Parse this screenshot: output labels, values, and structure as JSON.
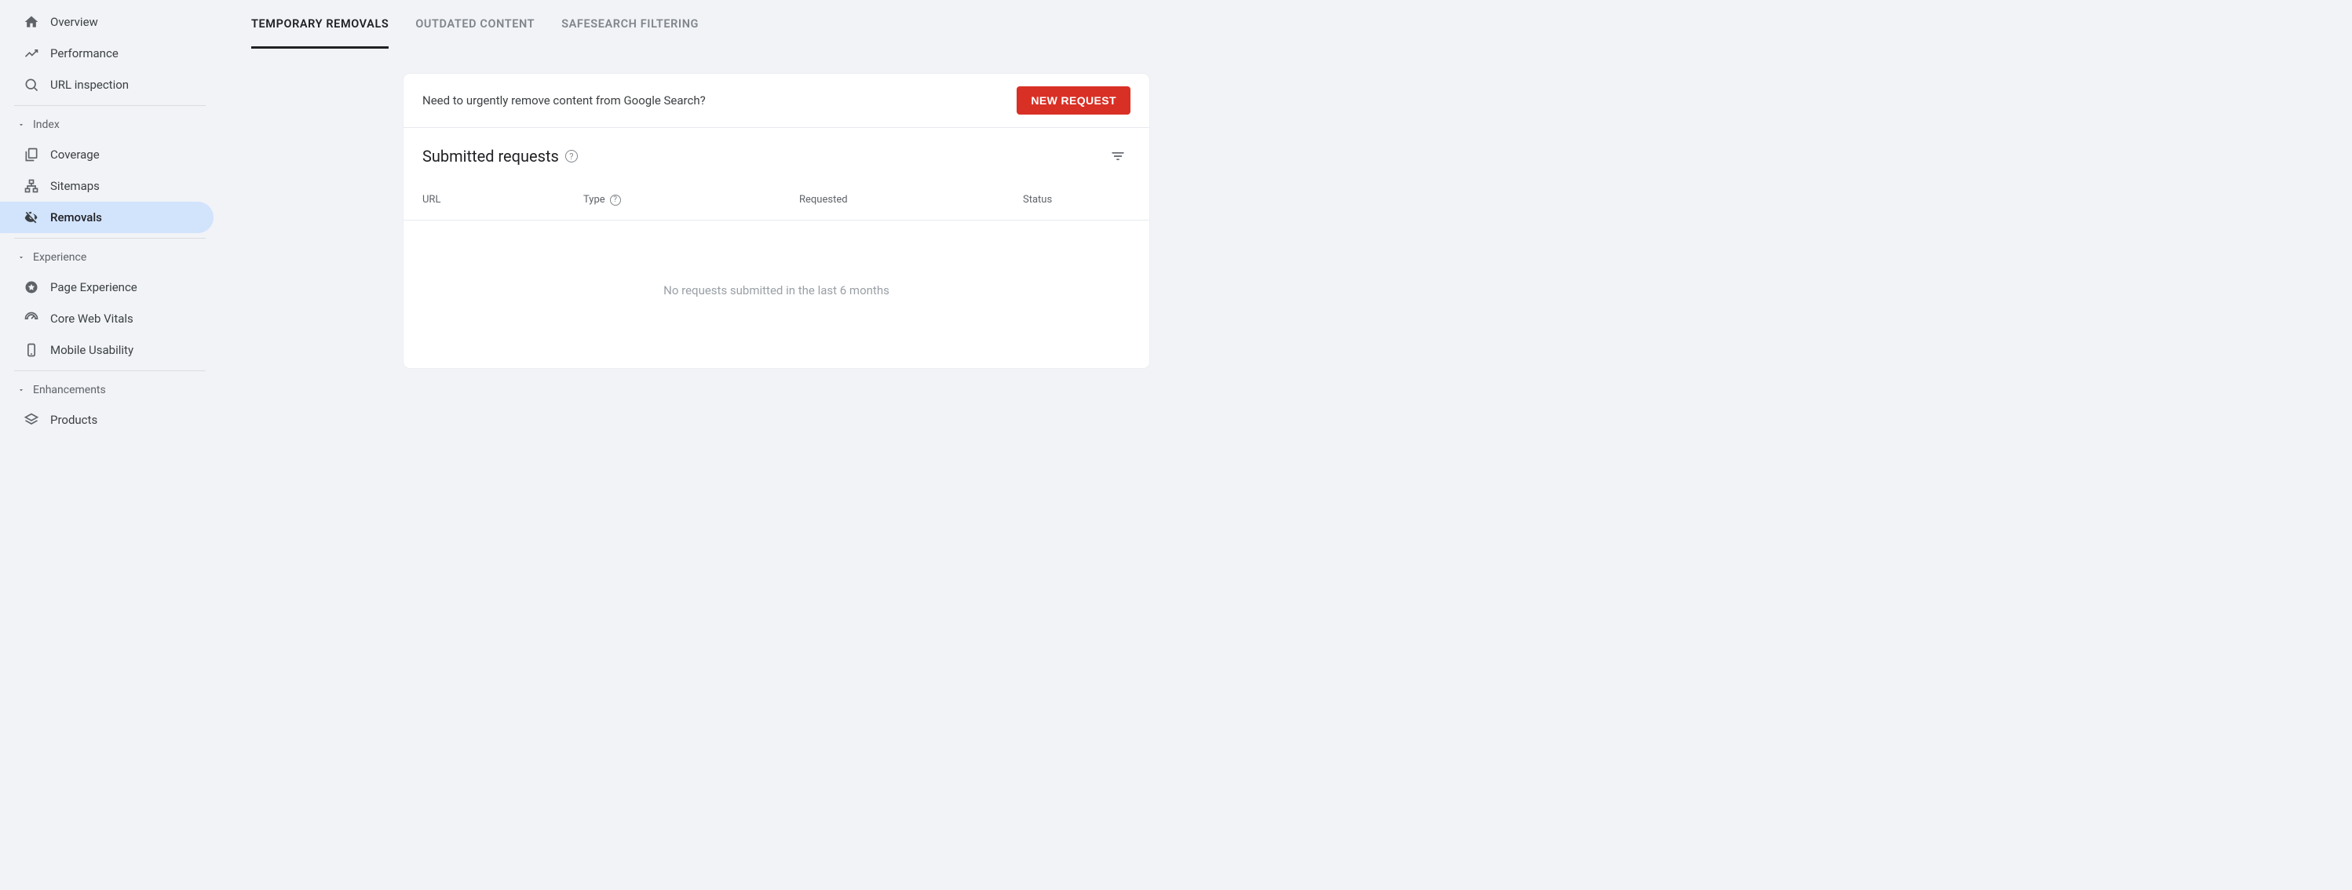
{
  "sidebar": {
    "items": [
      {
        "label": "Overview",
        "icon": "home-icon"
      },
      {
        "label": "Performance",
        "icon": "trend-icon"
      },
      {
        "label": "URL inspection",
        "icon": "search-icon"
      }
    ],
    "sections": [
      {
        "title": "Index",
        "items": [
          {
            "label": "Coverage",
            "icon": "pages-icon"
          },
          {
            "label": "Sitemaps",
            "icon": "sitemap-icon"
          },
          {
            "label": "Removals",
            "icon": "eye-off-icon",
            "active": true
          }
        ]
      },
      {
        "title": "Experience",
        "items": [
          {
            "label": "Page Experience",
            "icon": "badge-icon"
          },
          {
            "label": "Core Web Vitals",
            "icon": "gauge-icon"
          },
          {
            "label": "Mobile Usability",
            "icon": "mobile-icon"
          }
        ]
      },
      {
        "title": "Enhancements",
        "items": [
          {
            "label": "Products",
            "icon": "layers-icon"
          }
        ]
      }
    ]
  },
  "tabs": [
    {
      "label": "TEMPORARY REMOVALS",
      "active": true
    },
    {
      "label": "OUTDATED CONTENT"
    },
    {
      "label": "SAFESEARCH FILTERING"
    }
  ],
  "card": {
    "prompt": "Need to urgently remove content from Google Search?",
    "newRequestLabel": "NEW REQUEST",
    "title": "Submitted requests",
    "columns": {
      "url": "URL",
      "type": "Type",
      "requested": "Requested",
      "status": "Status"
    },
    "emptyMessage": "No requests submitted in the last 6 months"
  }
}
